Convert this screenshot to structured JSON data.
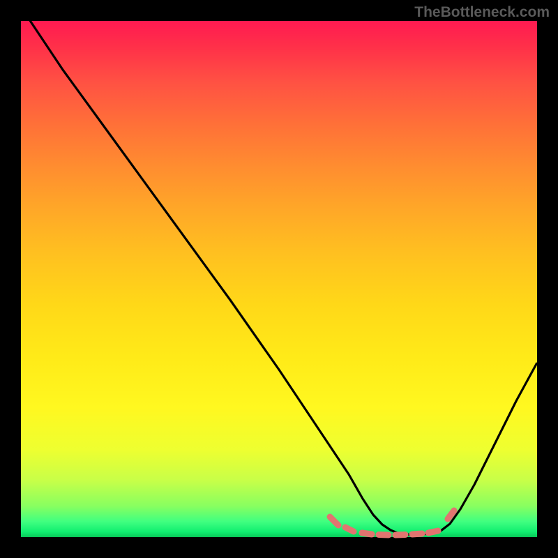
{
  "watermark": "TheBottleneck.com",
  "colors": {
    "background": "#000000",
    "curve": "#000000",
    "marker": "#e27470"
  },
  "chart_data": {
    "type": "line",
    "title": "",
    "xlabel": "",
    "ylabel": "",
    "xlim": [
      0,
      100
    ],
    "ylim": [
      0,
      100
    ],
    "x": [
      0,
      5,
      10,
      15,
      20,
      25,
      30,
      35,
      40,
      45,
      50,
      55,
      60,
      65,
      68,
      70,
      72,
      74,
      76,
      78,
      80,
      82,
      85,
      90,
      95,
      100
    ],
    "y": [
      100,
      92,
      83,
      75,
      67,
      58,
      50,
      42,
      33,
      25,
      17,
      10,
      5,
      2,
      1,
      0.5,
      0.3,
      0.3,
      0.3,
      0.3,
      0.5,
      1,
      3,
      10,
      20,
      33
    ],
    "markers_x": [
      61,
      63.5,
      66,
      68,
      70,
      72,
      74,
      76,
      78,
      80.5,
      81.5,
      82.5
    ],
    "markers_y": [
      2.2,
      1.4,
      0.8,
      0.5,
      0.4,
      0.35,
      0.35,
      0.35,
      0.4,
      0.6,
      1.0,
      1.8
    ],
    "gradient_bands": [
      {
        "pos": 0,
        "color": "#ff1a51"
      },
      {
        "pos": 50,
        "color": "#ffd818"
      },
      {
        "pos": 85,
        "color": "#eeff30"
      },
      {
        "pos": 100,
        "color": "#08c858"
      }
    ]
  }
}
